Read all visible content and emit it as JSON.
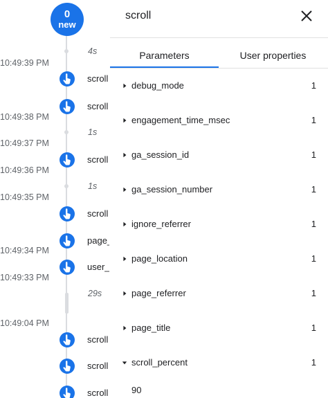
{
  "timeline": {
    "new_badge": {
      "count": "0",
      "label": "new"
    },
    "times": [
      "10:49:39 PM",
      "10:49:38 PM",
      "10:49:37 PM",
      "10:49:36 PM",
      "10:49:35 PM",
      "10:49:34 PM",
      "10:49:33 PM",
      "10:49:04 PM"
    ],
    "gaps": [
      "4s",
      "1s",
      "1s",
      "29s"
    ],
    "events": [
      "scroll",
      "scroll",
      "scroll",
      "scroll",
      "page_view",
      "user_engagement",
      "scroll",
      "scroll",
      "scroll"
    ]
  },
  "panel": {
    "title": "scroll",
    "tabs": [
      "Parameters",
      "User properties"
    ],
    "active_tab": "Parameters",
    "params": [
      {
        "name": "debug_mode",
        "count": "1"
      },
      {
        "name": "engagement_time_msec",
        "count": "1"
      },
      {
        "name": "ga_session_id",
        "count": "1"
      },
      {
        "name": "ga_session_number",
        "count": "1"
      },
      {
        "name": "ignore_referrer",
        "count": "1"
      },
      {
        "name": "page_location",
        "count": "1"
      },
      {
        "name": "page_referrer",
        "count": "1"
      },
      {
        "name": "page_title",
        "count": "1"
      },
      {
        "name": "scroll_percent",
        "count": "1",
        "expanded": true,
        "value": "90"
      }
    ]
  },
  "colors": {
    "accent": "#1a73e8",
    "line": "#dadce0",
    "muted": "#5f6368"
  }
}
